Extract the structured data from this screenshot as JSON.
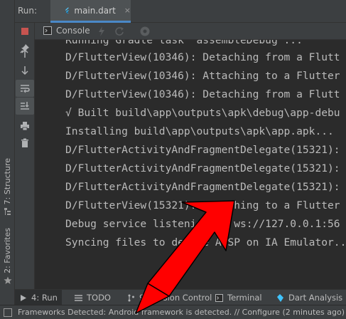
{
  "run_header": {
    "label": "Run:",
    "tab_label": "main.dart",
    "tab_close": "×"
  },
  "console_bar": {
    "tab_label": "Console"
  },
  "console": {
    "lines": [
      "Running Gradle task 'assembleDebug'...",
      "D/FlutterView(10346): Detaching from a Flutt",
      "D/FlutterView(10346): Attaching to a Flutter",
      "D/FlutterView(10346): Detaching from a Flutt",
      "√ Built build\\app\\outputs\\apk\\debug\\app-debu",
      "Installing build\\app\\outputs\\apk\\app.apk...",
      "D/FlutterActivityAndFragmentDelegate(15321):",
      "D/FlutterActivityAndFragmentDelegate(15321):",
      "D/FlutterActivityAndFragmentDelegate(15321):",
      "D/FlutterView(15321): Attaching to a Flutter",
      "Debug service listening on ws://127.0.0.1:56",
      "Syncing files to device AOSP on IA Emulator..."
    ]
  },
  "left_stripe": {
    "structure_label": "7: Structure",
    "favorites_label": "2: Favorites"
  },
  "bottom_tabs": {
    "run": "4: Run",
    "todo": "TODO",
    "version_control": "9: Version Control",
    "terminal": "Terminal",
    "dart_analysis": "Dart Analysis"
  },
  "status_bar": {
    "text": "Frameworks Detected: Android framework is detected. // Configure (2 minutes ago)"
  },
  "colors": {
    "background": "#2b2b2b",
    "panel": "#3c3f41",
    "text": "#bbbbbb",
    "accent": "#4a88c7",
    "stop_red": "#c75450",
    "annotation_red": "#ff0000"
  },
  "icons": {
    "flutter": "flutter-icon",
    "stop": "stop-icon",
    "pin": "pin-icon",
    "up": "arrow-up-icon",
    "down": "arrow-down-icon",
    "wrap": "soft-wrap-icon",
    "scroll_end": "scroll-to-end-icon",
    "print": "print-icon",
    "trash": "trash-icon",
    "console": "console-icon",
    "lightning": "lightning-icon",
    "hot_restart": "hot-restart-icon",
    "inspector": "inspector-icon",
    "structure": "structure-icon",
    "favorites": "star-icon",
    "status": "status-icon"
  }
}
